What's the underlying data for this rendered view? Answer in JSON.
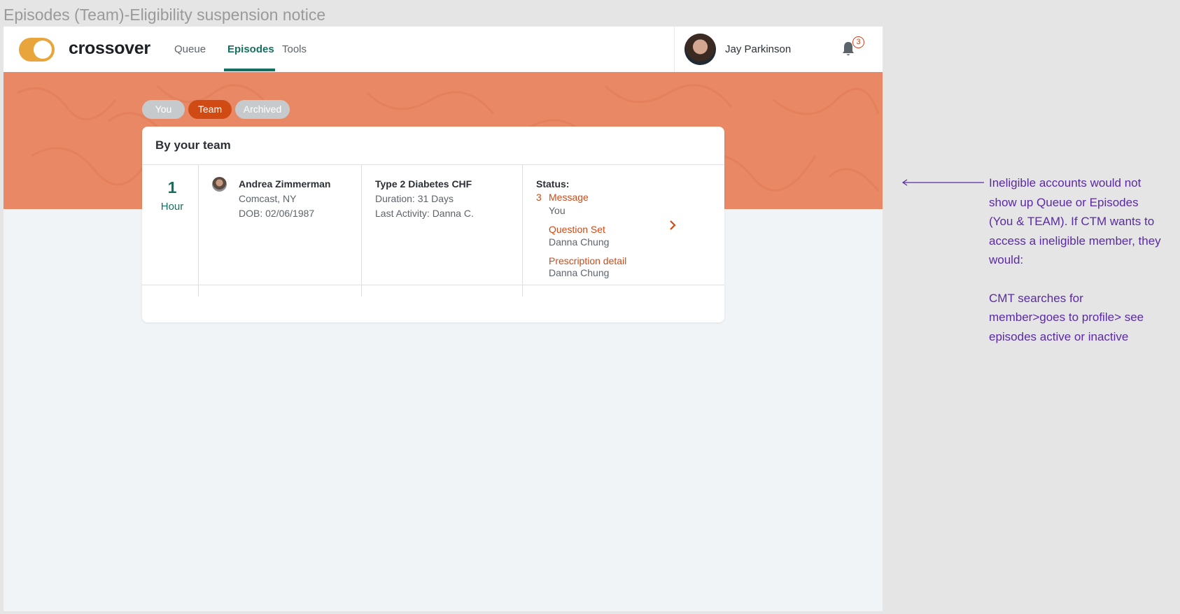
{
  "frame_title": "Episodes (Team)-Eligibility suspension notice",
  "header": {
    "brand": "crossover",
    "nav": [
      {
        "label": "Queue",
        "active": false
      },
      {
        "label": "Episodes",
        "active": true
      },
      {
        "label": "Tools",
        "active": false
      }
    ],
    "user_name": "Jay Parkinson",
    "notification_count": "3",
    "icons": [
      "toggle-switch",
      "avatar",
      "bell-icon"
    ]
  },
  "filters": {
    "pills": [
      {
        "label": "You",
        "active": false
      },
      {
        "label": "Team",
        "active": true
      },
      {
        "label": "Archived",
        "active": false
      }
    ]
  },
  "card": {
    "title": "By your team",
    "episode": {
      "time_value": "1",
      "time_unit": "Hour",
      "patient_name": "Andrea Zimmerman",
      "patient_location": "Comcast, NY",
      "patient_dob": "DOB: 02/06/1987",
      "condition": "Type 2 Diabetes CHF",
      "duration": "Duration: 31 Days",
      "last_activity": "Last Activity: Danna C.",
      "status_label": "Status:",
      "statuses": [
        {
          "count": "3",
          "label": "Message",
          "assignee": "You"
        },
        {
          "count": "",
          "label": "Question Set",
          "assignee": "Danna Chung"
        },
        {
          "count": "",
          "label": "Prescription detail",
          "assignee": "Danna Chung"
        }
      ]
    }
  },
  "annotation": {
    "paragraph1_lines": [
      "Ineligible accounts would not",
      "show up Queue or Episodes",
      "(You & TEAM).  If CTM wants to",
      "access a ineligible member, they",
      "would:"
    ],
    "paragraph2_lines": [
      "CMT searches for",
      "member>goes to profile> see",
      "episodes active or inactive"
    ]
  },
  "colors": {
    "accent_green": "#16705f",
    "accent_orange": "#d04a14",
    "hero": "#e98864",
    "toggle": "#e8a53b",
    "annotation": "#5b2aa3"
  }
}
